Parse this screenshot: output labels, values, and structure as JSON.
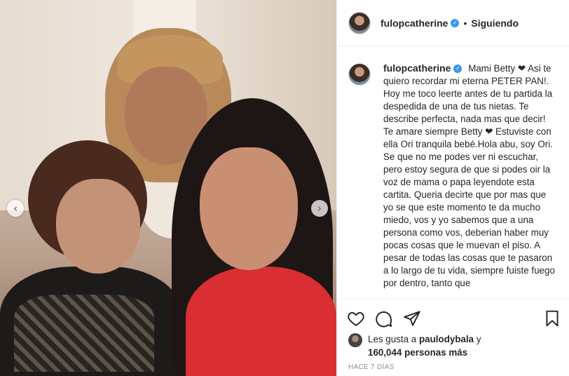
{
  "post": {
    "username": "fulopcatherine",
    "follow_status": "Siguiendo",
    "separator": "•",
    "caption": "Mami Betty ❤ Asi te quiero recordar mi eterna PETER PAN!. Hoy me toco leerte antes de tu partida la despedida de una de tus nietas. Te describe perfecta, nada mas que decir! Te amare siempre Betty ❤ Estuviste con ella Ori tranquila bebé.Hola abu, soy Ori. Se que no me podes ver ni escuchar, pero estoy segura de que si podes oir la voz de mama o papa leyendote esta cartita. Queria decirte que por mas que yo se que este momento te da mucho miedo, vos y yo sabemos que a una persona como vos, deberian haber muy pocas cosas que le muevan el piso. A pesar de todas las cosas que te pasaron a lo largo de tu vida, siempre fuiste fuego por dentro, tanto que",
    "likes_prefix": "Les gusta a",
    "liked_by": "paulodybala",
    "likes_connector": "y",
    "likes_count": "160,044 personas más",
    "timestamp": "HACE 7 DÍAS"
  },
  "carousel": {
    "prev_icon": "chevron-left-icon",
    "next_icon": "chevron-right-icon",
    "prev_glyph": "‹",
    "next_glyph": "›"
  },
  "colors": {
    "verified": "#3897f0",
    "heart": "#c0202a",
    "muted": "#8e8e8e"
  }
}
